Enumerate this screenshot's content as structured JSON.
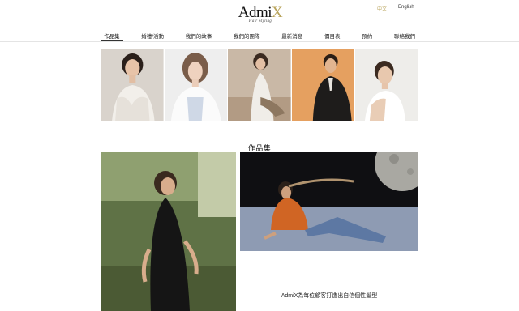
{
  "brand": {
    "name_main": "Admi",
    "name_accent": "X",
    "tagline_small": "Hair Styling"
  },
  "language": {
    "chinese": "中文",
    "english": "English"
  },
  "nav": {
    "items": [
      {
        "label": "作品集",
        "active": true
      },
      {
        "label": "婚禮/活動",
        "active": false
      },
      {
        "label": "我們的故事",
        "active": false
      },
      {
        "label": "我們的團隊",
        "active": false
      },
      {
        "label": "最新消息",
        "active": false
      },
      {
        "label": "價目表",
        "active": false
      },
      {
        "label": "預約",
        "active": false
      },
      {
        "label": "聯絡我們",
        "active": false
      }
    ]
  },
  "main": {
    "section_title": "作品集",
    "tagline": "AdmiX為每位顧客打造出自信個性髮型"
  },
  "colors": {
    "accent": "#b8a35a",
    "text": "#222222",
    "rule": "#e4e4e4"
  }
}
